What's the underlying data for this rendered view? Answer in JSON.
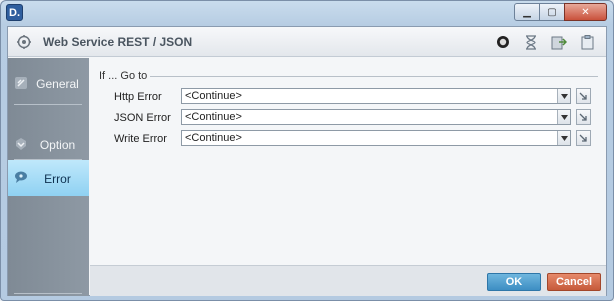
{
  "window": {
    "logo_text": "D.",
    "controls": {
      "minimize": "▁",
      "maximize": "▢",
      "close": "✕"
    }
  },
  "header": {
    "title": "Web Service REST / JSON",
    "tools": [
      "record-icon",
      "hourglass-icon",
      "export-icon",
      "clipboard-icon"
    ]
  },
  "sidebar": {
    "items": [
      {
        "label": "General",
        "icon": "general-icon",
        "active": false
      },
      {
        "label": "Option",
        "icon": "option-icon",
        "active": false
      },
      {
        "label": "Error",
        "icon": "error-icon",
        "active": true
      }
    ]
  },
  "main": {
    "group_label": "If ... Go to",
    "rows": [
      {
        "label": "Http Error",
        "value": "<Continue>"
      },
      {
        "label": "JSON Error",
        "value": "<Continue>"
      },
      {
        "label": "Write Error",
        "value": "<Continue>"
      }
    ]
  },
  "footer": {
    "ok_label": "OK",
    "cancel_label": "Cancel"
  },
  "colors": {
    "active_tab": "#8fd1f2",
    "ok": "#3d8ec3",
    "cancel": "#c65a3a",
    "sidebar": "#8e99a4"
  }
}
